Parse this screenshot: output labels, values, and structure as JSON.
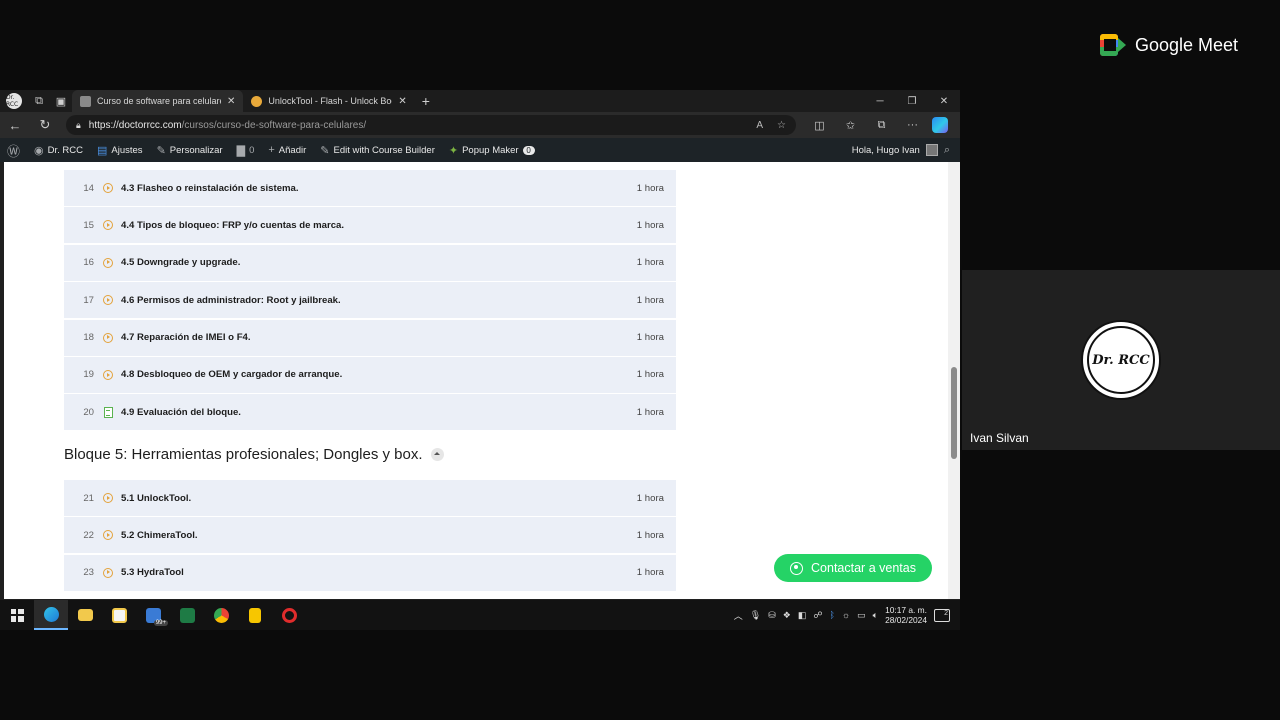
{
  "browser": {
    "tabs": [
      {
        "title": "Curso de software para celulares",
        "active": true
      },
      {
        "title": "UnlockTool - Flash - Unlock Boot",
        "active": false
      }
    ],
    "profile_label": "Dr. RCC",
    "url": {
      "domain": "https://doctorrcc.com",
      "path": "/cursos/curso-de-software-para-celulares/"
    }
  },
  "wp_bar": {
    "site_name": "Dr. RCC",
    "ajustes": "Ajustes",
    "personalizar": "Personalizar",
    "comments_count": "0",
    "anadir": "Añadir",
    "edit_course": "Edit with Course Builder",
    "popup_maker": "Popup Maker",
    "popup_count": "0",
    "greeting": "Hola, Hugo Ivan"
  },
  "lessons_block4": [
    {
      "num": "14",
      "title": "4.3 Flasheo o reinstalación de sistema.",
      "duration": "1 hora",
      "icon": "play-icon"
    },
    {
      "num": "15",
      "title": "4.4 Tipos de bloqueo: FRP y/o cuentas de marca.",
      "duration": "1 hora",
      "icon": "play-icon"
    },
    {
      "num": "16",
      "title": "4.5 Downgrade y upgrade.",
      "duration": "1 hora",
      "icon": "play-icon"
    },
    {
      "num": "17",
      "title": "4.6 Permisos de administrador: Root y jailbreak.",
      "duration": "1 hora",
      "icon": "play-icon"
    },
    {
      "num": "18",
      "title": "4.7 Reparación de IMEI o F4.",
      "duration": "1 hora",
      "icon": "play-icon"
    },
    {
      "num": "19",
      "title": "4.8 Desbloqueo de OEM y cargador de arranque.",
      "duration": "1 hora",
      "icon": "play-icon"
    },
    {
      "num": "20",
      "title": "4.9 Evaluación del bloque.",
      "duration": "1 hora",
      "icon": "document-icon"
    }
  ],
  "block5": {
    "title": "Bloque 5: Herramientas profesionales; Dongles y box.",
    "lessons": [
      {
        "num": "21",
        "title": "5.1 UnlockTool.",
        "duration": "1 hora",
        "icon": "play-icon"
      },
      {
        "num": "22",
        "title": "5.2 ChimeraTool.",
        "duration": "1 hora",
        "icon": "play-icon"
      },
      {
        "num": "23",
        "title": "5.3 HydraTool",
        "duration": "1 hora",
        "icon": "play-icon"
      }
    ]
  },
  "whatsapp_button": "Contactar a ventas",
  "taskbar": {
    "mail_badge": "99+",
    "time": "10:17 a. m.",
    "date": "28/02/2024",
    "notifications": "2"
  },
  "meet": {
    "brand": "Google Meet",
    "participant_name": "Ivan Silvan",
    "avatar_text": "Dr. RCC"
  },
  "colors": {
    "lesson_bg": "#ebeff7",
    "play_icon": "#e3a23b",
    "doc_icon": "#5ab34f",
    "whatsapp": "#25d366"
  }
}
